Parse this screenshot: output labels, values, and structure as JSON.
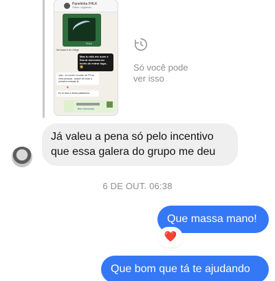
{
  "shared_image": {
    "chat_name": "Panelinha FHLK",
    "chat_subtitle": "Online • digitando...",
    "media_tag": "FHLK",
    "line_1": "Iris bravo e eu chego",
    "dark_bubble": "Mas tu não me ouve e fica aí mexendo ao invés de entrar logo.. 😂",
    "light_bubble_1": "Quiz.. eu mudei o trovão da TR ao meio pessoal.. acabei de botar a primeira emissão lá",
    "heart": "♥",
    "light_bubble_2": "Eu te tava a dessa plataforma",
    "attachment_text": "Bem demandar"
  },
  "view_once": {
    "icon": "view-once-icon",
    "text": "Só você pode ver isso"
  },
  "received_message": {
    "text": "Já valeu a pena só pelo incentivo que essa galera do grupo me deu"
  },
  "timestamp": "6 DE OUT. 06:38",
  "sent_messages": [
    {
      "text": "Que massa mano!",
      "reaction": "❤️"
    },
    {
      "text": "Que bom que tá te ajudando"
    }
  ],
  "colors": {
    "sent_bubble": "#3478f6",
    "received_bubble": "#efefef",
    "muted_text": "#8e8e8e",
    "reaction_heart": "#e8112d"
  }
}
